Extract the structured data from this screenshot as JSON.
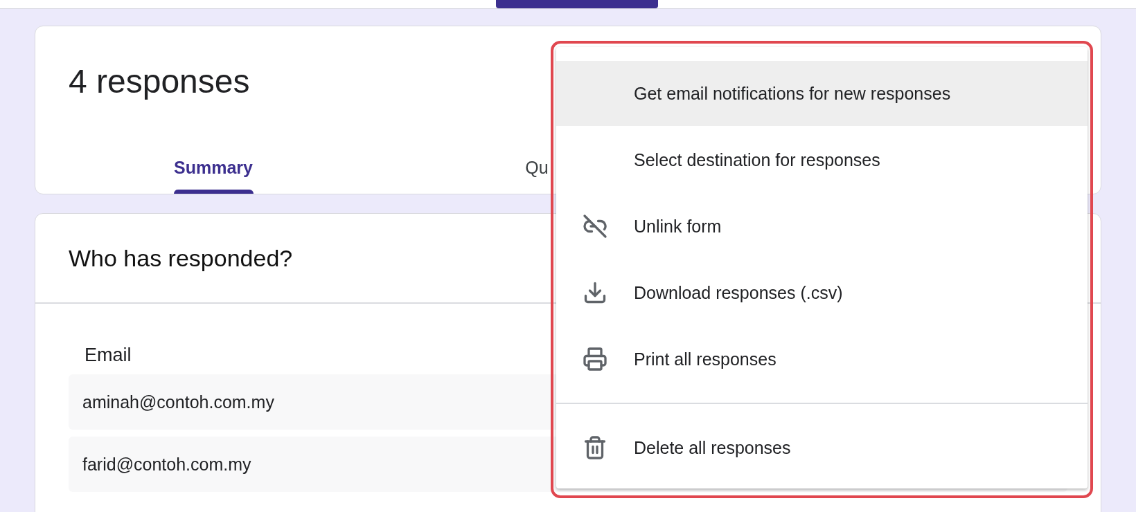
{
  "summary_card": {
    "title": "4 responses",
    "tabs": [
      {
        "label": "Summary",
        "selected": true
      },
      {
        "label": "Qu",
        "selected": false
      }
    ]
  },
  "respondents_card": {
    "title": "Who has responded?",
    "column": "Email",
    "rows": [
      "aminah@contoh.com.my",
      "farid@contoh.com.my"
    ]
  },
  "menu": {
    "groups": [
      [
        {
          "label": "Get email notifications for new responses",
          "highlighted": true
        },
        {
          "label": "Select destination for responses",
          "highlighted": false
        },
        {
          "label": "Unlink form",
          "kind": "unlink",
          "highlighted": false
        },
        {
          "label": "Download responses (.csv)",
          "kind": "download",
          "highlighted": false
        },
        {
          "label": "Print all responses",
          "kind": "print",
          "highlighted": false
        }
      ],
      [
        {
          "label": "Delete all responses",
          "kind": "delete",
          "highlighted": false
        }
      ]
    ]
  }
}
